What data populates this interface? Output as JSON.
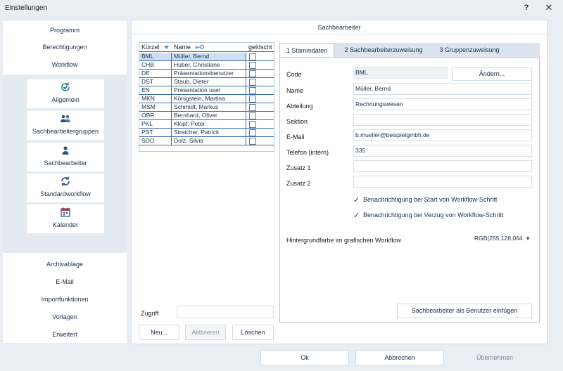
{
  "window": {
    "title": "Einstellungen",
    "help_glyph": "?",
    "close_glyph": "✕"
  },
  "sidebar": {
    "top_items": [
      "Programm",
      "Berechtigungen",
      "Workflow"
    ],
    "tiles": [
      {
        "label": "Allgemein",
        "icon": "refresh-check-icon"
      },
      {
        "label": "Sachbearbeitergruppen",
        "icon": "user-group-icon"
      },
      {
        "label": "Sachbearbeiter",
        "icon": "user-icon"
      },
      {
        "label": "Standardworkflow",
        "icon": "refresh-icon"
      },
      {
        "label": "Kalender",
        "icon": "calendar-icon"
      }
    ],
    "bottom_items": [
      "Archivablage",
      "E-Mail",
      "Importfunktionen",
      "Vorlagen",
      "Erweitert"
    ]
  },
  "main": {
    "header": "Sachbearbeiter",
    "grid": {
      "columns": [
        "Kürzel",
        "Name",
        "gelöscht"
      ],
      "rows": [
        {
          "code": "BML",
          "name": "Müller, Bernd"
        },
        {
          "code": "CHB",
          "name": "Huber, Christiane"
        },
        {
          "code": "DE",
          "name": "Präsentationsbenutzer"
        },
        {
          "code": "DST",
          "name": "Staub, Dieter"
        },
        {
          "code": "EN",
          "name": "Presentation user"
        },
        {
          "code": "MKN",
          "name": "Königstein, Martina"
        },
        {
          "code": "MSM",
          "name": "Schmidt, Markus"
        },
        {
          "code": "OBR",
          "name": "Bernhard, Oliver"
        },
        {
          "code": "PKL",
          "name": "Klopf, Peter"
        },
        {
          "code": "PST",
          "name": "Streicher, Patrick"
        },
        {
          "code": "SDO",
          "name": "Dolz, Silvia"
        }
      ]
    },
    "zugriff_label": "Zugriff",
    "zugriff_value": "",
    "buttons": {
      "new": "Neu...",
      "activate": "Aktivieren",
      "delete": "Löschen"
    }
  },
  "tabs": [
    "1 Stammdaten",
    "2 Sachbearbeiterzuweisung",
    "3 Gruppenzuweisung"
  ],
  "detail": {
    "code_label": "Code",
    "code_value": "BML",
    "change_button": "Ändern...",
    "name_label": "Name",
    "name_value": "Müller, Bernd",
    "abteilung_label": "Abteilung",
    "abteilung_value": "Rechnungswesen",
    "sektion_label": "Sektion",
    "sektion_value": "",
    "email_label": "E-Mail",
    "email_value": "b.mueller@beispielgmbh.de",
    "telefon_label": "Telefon (intern)",
    "telefon_value": "335",
    "zusatz1_label": "Zusatz 1",
    "zusatz1_value": "",
    "zusatz2_label": "Zusatz 2",
    "zusatz2_value": "",
    "check1": "Benachrichtigung bei Start von Workflow-Schritt",
    "check2": "Benachrichtigung bei Verzug von Workflow-Schritt",
    "check_mark": "✓",
    "bg_label": "Hintergrundfarbe im grafischen Workflow",
    "bg_value": "RGB(255,128,064",
    "select_arrow": "▼",
    "add_user_button": "Sachbearbeiter als Benutzer einfügen"
  },
  "footer": {
    "ok": "Ok",
    "cancel": "Abbrechen",
    "apply": "Übernehmen"
  }
}
